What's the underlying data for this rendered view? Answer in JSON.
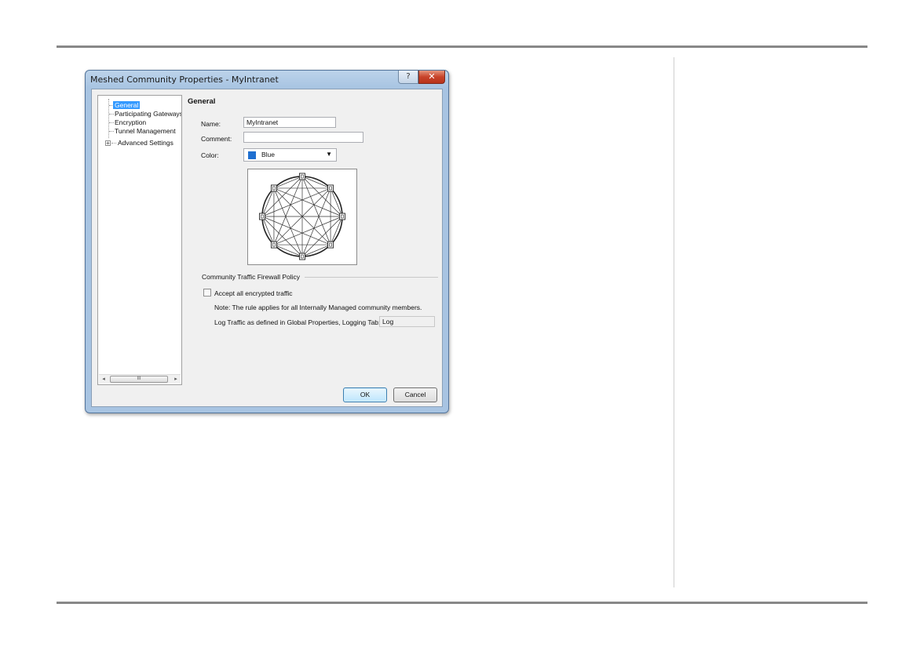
{
  "dialog": {
    "title": "Meshed Community Properties - MyIntranet",
    "help_glyph": "?",
    "close_glyph": "✕"
  },
  "tree": {
    "items": [
      {
        "label": "General",
        "selected": true
      },
      {
        "label": "Participating Gateways"
      },
      {
        "label": "Encryption"
      },
      {
        "label": "Tunnel Management"
      },
      {
        "label": "Advanced Settings",
        "expandable": true
      }
    ],
    "expander_glyph": "+",
    "scroll_left": "◂",
    "scroll_right": "▸",
    "scroll_thumb_grip": "III"
  },
  "general": {
    "section_title": "General",
    "name_label": "Name:",
    "name_value": "MyIntranet",
    "comment_label": "Comment:",
    "comment_value": "",
    "color_label": "Color:",
    "color_value": "Blue",
    "color_swatch": "#1f6fd0",
    "topology_icon": "meshed-community-icon"
  },
  "policy": {
    "group_title": "Community Traffic Firewall Policy",
    "accept_label": "Accept all encrypted traffic",
    "accept_checked": false,
    "note": "Note: The rule applies for all Internally Managed community members.",
    "log_label": "Log Traffic as defined in Global Properties, Logging Tab:",
    "log_value": "Log"
  },
  "buttons": {
    "ok": "OK",
    "cancel": "Cancel"
  }
}
